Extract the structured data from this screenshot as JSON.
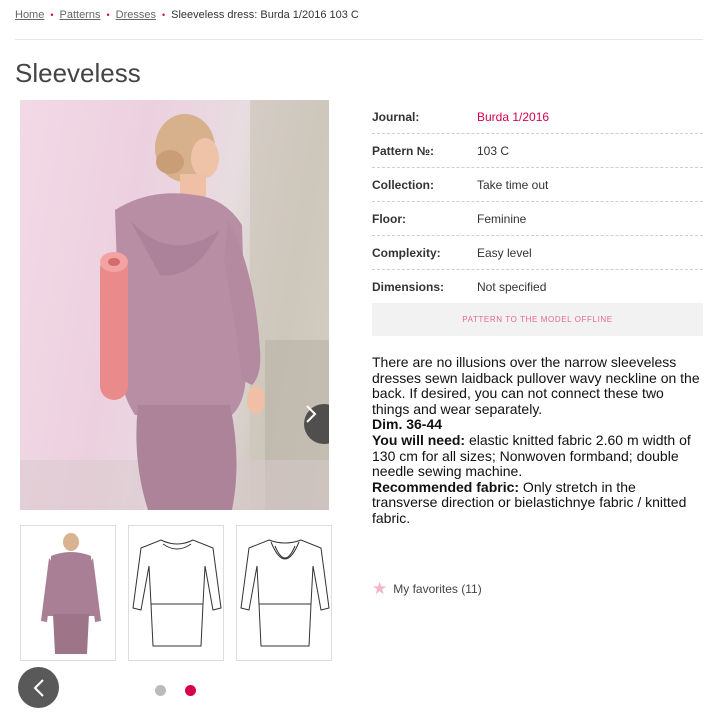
{
  "breadcrumb": {
    "home": "Home",
    "patterns": "Patterns",
    "dresses": "Dresses",
    "current": "Sleeveless dress: Burda 1/2016 103 C",
    "separator": "•"
  },
  "page_title": "Sleeveless",
  "gallery": {
    "main_image_icon": "woman-in-dress-photo",
    "next_icon": "chevron-right-icon",
    "prev_icon": "chevron-left-icon",
    "thumbnails": [
      "dress-photo-thumbnail",
      "dress-front-sketch-thumbnail",
      "dress-back-sketch-thumbnail"
    ],
    "active_dot": 1
  },
  "details": [
    {
      "label": "Journal:",
      "value": "Burda 1/2016",
      "link": true
    },
    {
      "label": "Pattern №:",
      "value": "103 C",
      "link": false
    },
    {
      "label": "Collection:",
      "value": "Take time out",
      "link": false
    },
    {
      "label": "Floor:",
      "value": "Feminine",
      "link": false
    },
    {
      "label": "Complexity:",
      "value": "Easy level",
      "link": false
    },
    {
      "label": "Dimensions:",
      "value": "Not specified",
      "link": false
    }
  ],
  "offline_button": "PATTERN TO THE MODEL OFFLINE",
  "description": {
    "intro": "There are no illusions over the narrow sleeveless dresses sewn laidback pullover wavy neckline on the back. If desired, you can not connect these two things and wear separately.",
    "dim_label": "Dim. 36-44",
    "need_label": "You will need:",
    "need_text": " elastic knitted fabric 2.60 m width of 130 cm for all sizes; Nonwoven formband; double needle sewing machine.",
    "fabric_label": "Recommended fabric:",
    "fabric_text": " Only stretch in the transverse direction or bielastichnye fabric / knitted fabric."
  },
  "favorites": {
    "icon": "star-icon",
    "label": "My favorites (11)"
  },
  "colors": {
    "accent": "#d6004f"
  }
}
